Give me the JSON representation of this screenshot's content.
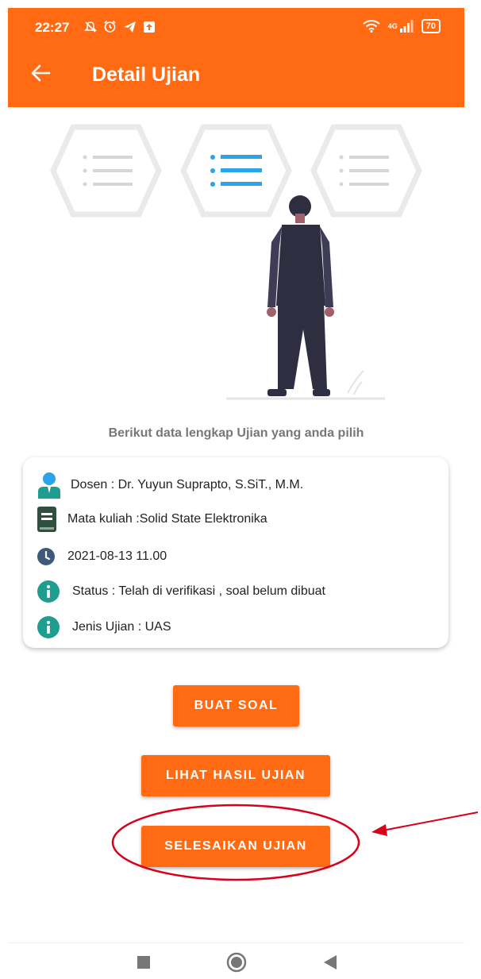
{
  "status_bar": {
    "time": "22:27",
    "network": "4G",
    "battery": "70",
    "icons": [
      "mute-bell-icon",
      "alarm-icon",
      "telegram-icon",
      "upload-icon",
      "wifi-icon",
      "signal-icon",
      "battery-icon"
    ]
  },
  "app_bar": {
    "title": "Detail Ujian",
    "back_icon": "arrow-left-icon"
  },
  "illustration": {
    "description_icon": "person-list-illustration"
  },
  "caption": "Berikut data lengkap Ujian yang anda pilih",
  "details": {
    "dosen": "Dosen : Dr. Yuyun Suprapto, S.SiT., M.M.",
    "mata_kuliah": "Mata kuliah :Solid State Elektronika",
    "datetime": "2021-08-13 11.00",
    "status": "Status : Telah di verifikasi , soal belum dibuat",
    "jenis": "Jenis Ujian : UAS"
  },
  "buttons": {
    "buat_soal": "BUAT SOAL",
    "lihat_hasil": "LIHAT HASIL UJIAN",
    "selesaikan": "SELESAIKAN UJIAN"
  },
  "nav": {
    "icons": [
      "recents-icon",
      "home-icon",
      "back-icon"
    ]
  },
  "colors": {
    "primary": "#ff6a13",
    "accent_blue": "#2aa3e8",
    "annotation_red": "#d9001b",
    "icon_teal": "#1f9e8f",
    "icon_dark_green": "#2f4f3f",
    "icon_slate": "#3e5a7a"
  }
}
